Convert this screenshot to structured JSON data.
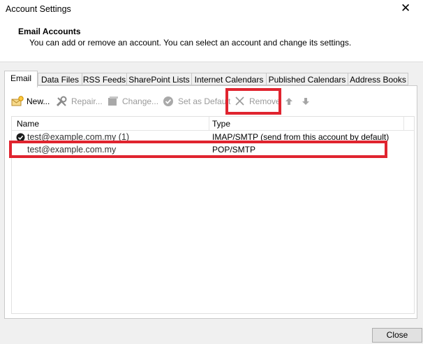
{
  "window": {
    "title": "Account Settings",
    "close_glyph": "✕"
  },
  "header": {
    "title": "Email Accounts",
    "description": "You can add or remove an account. You can select an account and change its settings."
  },
  "tabs": [
    {
      "label": "Email",
      "active": true
    },
    {
      "label": "Data Files"
    },
    {
      "label": "RSS Feeds"
    },
    {
      "label": "SharePoint Lists"
    },
    {
      "label": "Internet Calendars"
    },
    {
      "label": "Published Calendars"
    },
    {
      "label": "Address Books"
    }
  ],
  "toolbar": {
    "new_label": "New...",
    "repair_label": "Repair...",
    "change_label": "Change...",
    "set_default_label": "Set as Default",
    "remove_label": "Remove"
  },
  "list": {
    "columns": {
      "name": "Name",
      "type": "Type"
    },
    "rows": [
      {
        "name": "test@example.com.my (1)",
        "type": "IMAP/SMTP (send from this account by default)",
        "default": true
      },
      {
        "name": "test@example.com.my",
        "type": "POP/SMTP",
        "default": false
      }
    ]
  },
  "footer": {
    "close_label": "Close"
  },
  "colors": {
    "highlight": "#e0242f",
    "disabled_text": "#9a9a9a"
  }
}
